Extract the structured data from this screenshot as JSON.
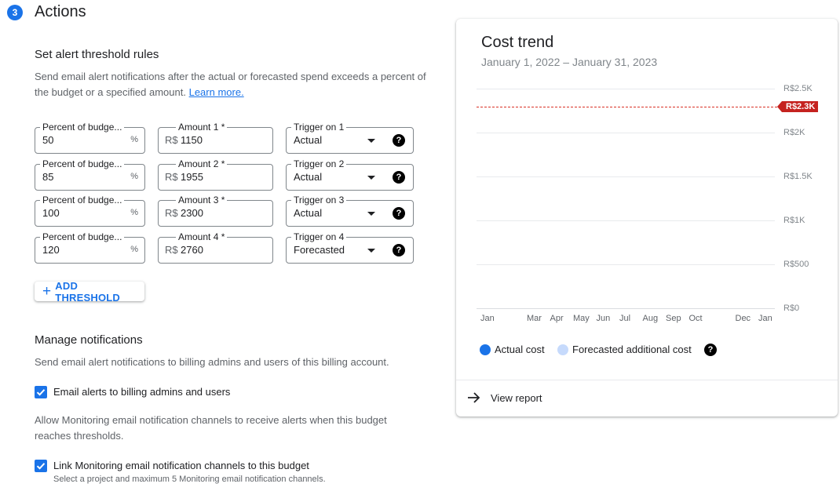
{
  "header": {
    "step": "3",
    "title": "Actions"
  },
  "thresholds": {
    "heading": "Set alert threshold rules",
    "help_text": "Send email alert notifications after the actual or forecasted spend exceeds a percent of the budget or a specified amount.",
    "learn_more": "Learn more.",
    "rows": [
      {
        "percent_label": "Percent of budge...",
        "percent": "50",
        "percent_suffix": "%",
        "amount_label": "Amount 1 *",
        "currency": "R$",
        "amount": "1150",
        "trigger_label": "Trigger on 1",
        "trigger": "Actual"
      },
      {
        "percent_label": "Percent of budge...",
        "percent": "85",
        "percent_suffix": "%",
        "amount_label": "Amount 2 *",
        "currency": "R$",
        "amount": "1955",
        "trigger_label": "Trigger on 2",
        "trigger": "Actual"
      },
      {
        "percent_label": "Percent of budge...",
        "percent": "100",
        "percent_suffix": "%",
        "amount_label": "Amount 3 *",
        "currency": "R$",
        "amount": "2300",
        "trigger_label": "Trigger on 3",
        "trigger": "Actual"
      },
      {
        "percent_label": "Percent of budge...",
        "percent": "120",
        "percent_suffix": "%",
        "amount_label": "Amount 4 *",
        "currency": "R$",
        "amount": "2760",
        "trigger_label": "Trigger on 4",
        "trigger": "Forecasted"
      }
    ],
    "help_icon": "?",
    "add_button": "ADD THRESHOLD"
  },
  "notifications": {
    "heading": "Manage notifications",
    "help_text": "Send email alert notifications to billing admins and users of this billing account.",
    "email_alerts_label": "Email alerts to billing admins and users",
    "email_alerts_checked": true,
    "monitoring_help": "Allow Monitoring email notification channels to receive alerts when this budget reaches thresholds.",
    "link_monitoring_label": "Link Monitoring email notification channels to this budget",
    "link_monitoring_checked": true,
    "link_monitoring_sub": "Select a project and maximum 5 Monitoring email notification channels."
  },
  "card": {
    "title": "Cost trend",
    "date_range": "January 1, 2022 – January 31, 2023",
    "legend_actual": "Actual cost",
    "legend_forecast": "Forecasted additional cost",
    "view_report": "View report",
    "budget_marker": "R$2.3K"
  },
  "chart_data": {
    "type": "area",
    "title": "Cost trend",
    "subtitle": "January 1, 2022 – January 31, 2023",
    "x": [
      "Jan",
      "Mar",
      "Apr",
      "May",
      "Jun",
      "Jul",
      "Aug",
      "Sep",
      "Oct",
      "Dec",
      "Jan"
    ],
    "y_ticks": [
      "R$2.5K",
      "R$2K",
      "R$1.5K",
      "R$1K",
      "R$500",
      "R$0"
    ],
    "ylim": [
      0,
      2500
    ],
    "series": [
      {
        "name": "Actual cost",
        "values": [],
        "color": "#1a73e8"
      },
      {
        "name": "Forecasted additional cost",
        "values": [],
        "color": "#c6dafc"
      }
    ],
    "budget_line": {
      "value": 2300,
      "label": "R$2.3K",
      "color": "#d93025"
    },
    "grid": true,
    "legend_position": "bottom"
  }
}
